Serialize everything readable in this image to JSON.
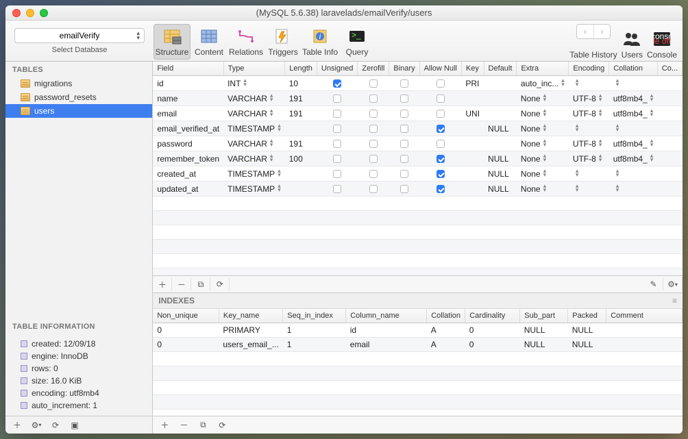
{
  "title": "(MySQL 5.6.38) laravelads/emailVerify/users",
  "sidebar": {
    "db_select": "emailVerify",
    "db_label": "Select Database",
    "tables_header": "TABLES",
    "tables": [
      "migrations",
      "password_resets",
      "users"
    ],
    "selected_table": "users",
    "info_header": "TABLE INFORMATION",
    "info": [
      "created: 12/09/18",
      "engine: InnoDB",
      "rows: 0",
      "size: 16.0 KiB",
      "encoding: utf8mb4",
      "auto_increment: 1"
    ]
  },
  "toolbar": {
    "items": [
      "Structure",
      "Content",
      "Relations",
      "Triggers",
      "Table Info",
      "Query"
    ],
    "selected": "Structure",
    "right": {
      "history": "Table History",
      "users": "Users",
      "console": "Console"
    }
  },
  "fields": {
    "headers": [
      "Field",
      "Type",
      "Length",
      "Unsigned",
      "Zerofill",
      "Binary",
      "Allow Null",
      "Key",
      "Default",
      "Extra",
      "Encoding",
      "Collation",
      "Co..."
    ],
    "rows": [
      {
        "field": "id",
        "type": "INT",
        "length": "10",
        "unsigned": true,
        "zerofill": false,
        "binary": false,
        "null": false,
        "key": "PRI",
        "default": "",
        "extra": "auto_inc...",
        "encoding": "",
        "collation": ""
      },
      {
        "field": "name",
        "type": "VARCHAR",
        "length": "191",
        "unsigned": false,
        "zerofill": false,
        "binary": false,
        "null": false,
        "key": "",
        "default": "",
        "extra": "None",
        "encoding": "UTF-8",
        "collation": "utf8mb4_"
      },
      {
        "field": "email",
        "type": "VARCHAR",
        "length": "191",
        "unsigned": false,
        "zerofill": false,
        "binary": false,
        "null": false,
        "key": "UNI",
        "default": "",
        "extra": "None",
        "encoding": "UTF-8",
        "collation": "utf8mb4_"
      },
      {
        "field": "email_verified_at",
        "type": "TIMESTAMP",
        "length": "",
        "unsigned": false,
        "zerofill": false,
        "binary": false,
        "null": true,
        "key": "",
        "default": "NULL",
        "extra": "None",
        "encoding": "",
        "collation": ""
      },
      {
        "field": "password",
        "type": "VARCHAR",
        "length": "191",
        "unsigned": false,
        "zerofill": false,
        "binary": false,
        "null": false,
        "key": "",
        "default": "",
        "extra": "None",
        "encoding": "UTF-8",
        "collation": "utf8mb4_"
      },
      {
        "field": "remember_token",
        "type": "VARCHAR",
        "length": "100",
        "unsigned": false,
        "zerofill": false,
        "binary": false,
        "null": true,
        "key": "",
        "default": "NULL",
        "extra": "None",
        "encoding": "UTF-8",
        "collation": "utf8mb4_"
      },
      {
        "field": "created_at",
        "type": "TIMESTAMP",
        "length": "",
        "unsigned": false,
        "zerofill": false,
        "binary": false,
        "null": true,
        "key": "",
        "default": "NULL",
        "extra": "None",
        "encoding": "",
        "collation": ""
      },
      {
        "field": "updated_at",
        "type": "TIMESTAMP",
        "length": "",
        "unsigned": false,
        "zerofill": false,
        "binary": false,
        "null": true,
        "key": "",
        "default": "NULL",
        "extra": "None",
        "encoding": "",
        "collation": ""
      }
    ],
    "blank_rows": 8
  },
  "indexes": {
    "header": "INDEXES",
    "headers": [
      "Non_unique",
      "Key_name",
      "Seq_in_index",
      "Column_name",
      "Collation",
      "Cardinality",
      "Sub_part",
      "Packed",
      "Comment"
    ],
    "rows": [
      {
        "nu": "0",
        "kn": "PRIMARY",
        "si": "1",
        "cn": "id",
        "col": "A",
        "card": "0",
        "sp": "NULL",
        "pk": "NULL",
        "cm": ""
      },
      {
        "nu": "0",
        "kn": "users_email_...",
        "si": "1",
        "cn": "email",
        "col": "A",
        "card": "0",
        "sp": "NULL",
        "pk": "NULL",
        "cm": ""
      }
    ],
    "blank_rows": 5
  }
}
